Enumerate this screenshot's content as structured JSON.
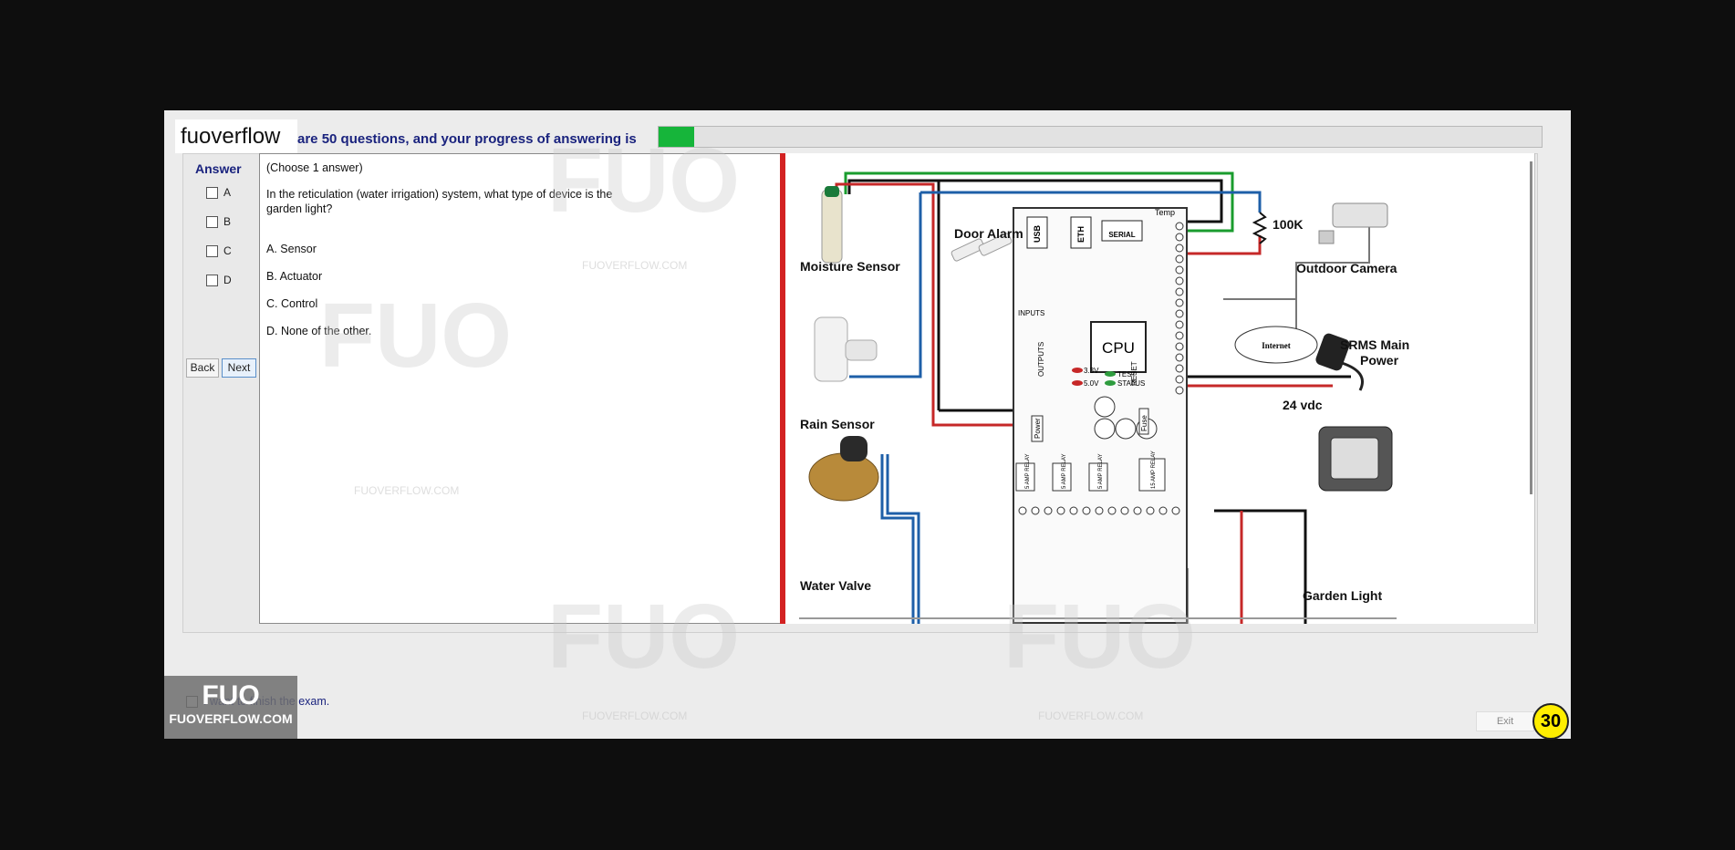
{
  "header": {
    "logo": "fuoverflow",
    "progress_label": "are 50 questions, and your progress of answering is",
    "progress_value": 0.04
  },
  "answer_panel": {
    "title": "Answer",
    "options": [
      "A",
      "B",
      "C",
      "D"
    ],
    "back_label": "Back",
    "next_label": "Next"
  },
  "question": {
    "instruction": "(Choose 1 answer)",
    "text_line1": "In the reticulation  (water irrigation) system, what type of device is the",
    "text_line2": "garden light?",
    "choices": [
      "A.  Sensor",
      "B.  Actuator",
      "C.  Control",
      "D.  None of the other."
    ]
  },
  "diagram": {
    "labels": {
      "moisture_sensor": "Moisture Sensor",
      "rain_sensor": "Rain Sensor",
      "water_valve": "Water Valve",
      "door_alarm": "Door Alarm",
      "resistor": "100K",
      "outdoor_camera": "Outdoor Camera",
      "internet": "Internet",
      "srms_line1": "SRMS Main",
      "srms_line2": "Power",
      "vdc": "24 vdc",
      "garden_light": "Garden Light",
      "cpu": "CPU",
      "usb": "USB",
      "eth": "ETH",
      "serial": "SERIAL",
      "temp": "Temp",
      "inputs": "INPUTS",
      "outputs": "OUTPUTS",
      "reset": "RESET",
      "test": "TEST",
      "status": "STATUS",
      "v33": "3.3V",
      "v50": "5.0V",
      "power": "Power",
      "fuse": "Fuse",
      "relay": "5 AMP RELAY",
      "relay15": "15 AMP RELAY"
    }
  },
  "footer": {
    "finish_label": "I want to finish the exam.",
    "exit_label": "Exit",
    "timer": "30"
  },
  "watermark": {
    "big": "FUO",
    "small": "FUOVERFLOW.COM"
  }
}
